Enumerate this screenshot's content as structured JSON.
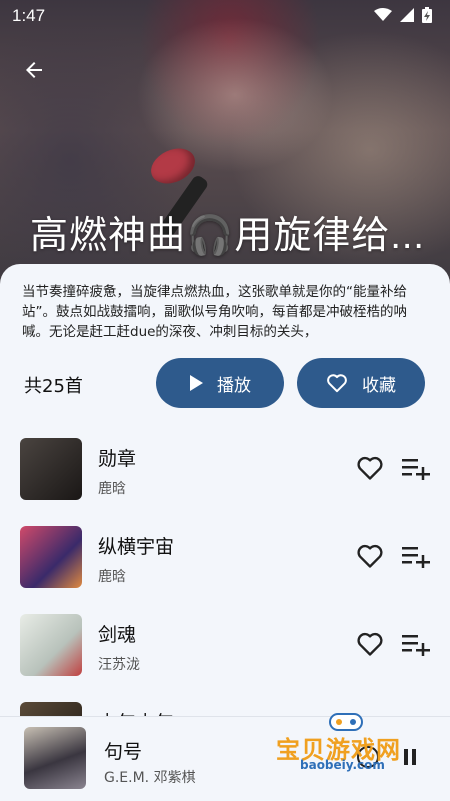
{
  "status_bar": {
    "time": "1:47"
  },
  "playlist": {
    "title": "高燃神曲🎧用旋律给...",
    "description": "当节奏撞碎疲惫，当旋律点燃热血，这张歌单就是你的“能量补给站”。鼓点如战鼓擂响，副歌似号角吹响，每首都是冲破桎梏的呐喊。无论是赶工赶due的深夜、冲刺目标的关头，",
    "count_label": "共25首",
    "play_label": "播放",
    "favorite_label": "收藏"
  },
  "songs": [
    {
      "title": "勋章",
      "artist": "鹿晗",
      "cover_color": "#2a2624"
    },
    {
      "title": "纵横宇宙",
      "artist": "鹿晗",
      "cover_color": "#c23a5a"
    },
    {
      "title": "剑魂",
      "artist": "汪苏泷",
      "cover_color": "#d8dcd6"
    },
    {
      "title": "少年少年",
      "artist": "",
      "cover_color": "#3a3028"
    }
  ],
  "now_playing": {
    "title": "句号",
    "artist": "G.E.M. 邓紫棋"
  },
  "watermark": {
    "name": "宝贝游戏网",
    "url": "baobeiy.com"
  },
  "colors": {
    "accent": "#2e5a8c",
    "background": "#f3f6fb"
  }
}
